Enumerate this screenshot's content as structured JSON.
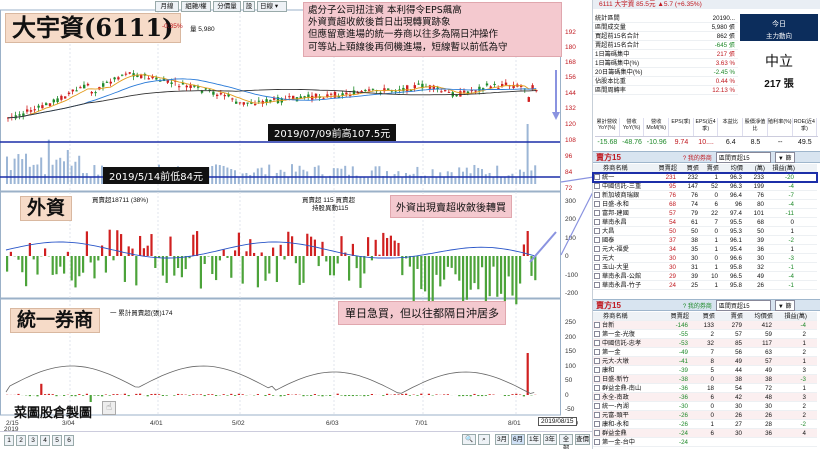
{
  "toolbar": {
    "a": "月線",
    "b": "組雜/權",
    "c": "分價量",
    "d": "設",
    "period": "日線"
  },
  "annot": {
    "title": "大宇資(6111)",
    "price_change": "-0.35%",
    "vol": "量 5,980",
    "note": [
      "處分子公司扭注資 本利得令EPS飆高",
      "外資賣超收斂後首日出現轉買跡象",
      "但應留意進場的統一券商以往多為隔日沖操作",
      "可等站上頸線後再伺機進場，短線暫以前低為守"
    ],
    "high_label": "2019/07/09前高107.5元",
    "low_label": "2019/5/14前低84元",
    "foreign": "外資",
    "foreign_note": "外資出現賣超收斂後轉買",
    "foreign_legend_a": "買賣超18711 (38%)",
    "foreign_legend_b": "買賣超 115 買賣超",
    "foreign_legend_c": "持股異動115",
    "broker": "統一券商",
    "broker_note": "單日急買，但以往都隔日沖居多",
    "broker_legend": "一 累計買賣超(張)174",
    "watermark": "菜圖股倉製圖",
    "date_box": "2019/08/15"
  },
  "x_axis": {
    "labels": [
      "2/15",
      "3/04",
      "4/01",
      "5/02",
      "6/03",
      "7/01",
      "8/01"
    ],
    "year": "2019"
  },
  "price_axis": [
    "192",
    "180",
    "168",
    "156",
    "144",
    "132",
    "120",
    "108",
    "96",
    "84",
    "72"
  ],
  "foreign_axis": [
    "300",
    "200",
    "100",
    "0",
    "-100",
    "-200",
    "-300"
  ],
  "broker_axis": [
    "250",
    "200",
    "150",
    "100",
    "50",
    "0",
    "-50",
    "-100"
  ],
  "bottom_bar": {
    "pages": [
      "1",
      "2",
      "3",
      "4",
      "5",
      "6"
    ],
    "periods": [
      "3月",
      "6月",
      "1年",
      "3年",
      "全部",
      "查價"
    ]
  },
  "panel": {
    "stock_line": "6111 大宇資 85.5元 ▲5.7 (+6.35%)",
    "stats": [
      [
        "統計區間",
        "20190..."
      ],
      [
        "區間成交量",
        "5,980 張"
      ],
      [
        "買超前15名合計",
        "862 張"
      ],
      [
        "賣超前15名合計",
        "-645 張"
      ],
      [
        "1日籌碼集中",
        "217 張"
      ],
      [
        "1日籌碼集中(%)",
        "3.63 %"
      ],
      [
        "20日籌碼集中(%)",
        "-2.45 %"
      ],
      [
        "佔股本比重",
        "0.44 %"
      ],
      [
        "區間周轉率",
        "12.13 %"
      ]
    ],
    "today_title": "今日",
    "today_sub": "主力動向",
    "today_status": "中立",
    "today_value": "217 張",
    "fin_heads": [
      "累計營收YoY(%)",
      "營收YoY(%)",
      "營收MoM(%)",
      "EPS(季)",
      "EPS(近4季)",
      "本益比",
      "股價淨值比",
      "殖利率(%)",
      "ROE(近4季)"
    ],
    "fin_vals": [
      "-15.68",
      "-48.76",
      "-10.96",
      "9.74",
      "10....",
      "6.4",
      "8.5",
      "--",
      "49.5"
    ],
    "buy_title": "賣方15",
    "sell_title": "賣方15",
    "sec_tag": "? 我的券商",
    "sec_sel": "區間買超15",
    "sec_btn": "▼ 篩",
    "cols": [
      "券商名稱",
      "買賣超",
      "買張",
      "賣張",
      "均價",
      "(萬)",
      "損益(萬)"
    ],
    "buy_rows": [
      [
        "統一",
        "231",
        "232",
        "1",
        "96.3",
        "233",
        "-20"
      ],
      [
        "中國信託-三重",
        "95",
        "147",
        "52",
        "96.3",
        "199",
        "-4"
      ],
      [
        "新加坡商瑞銀",
        "76",
        "76",
        "0",
        "96.4",
        "76",
        "-7"
      ],
      [
        "日盛-永和",
        "68",
        "74",
        "6",
        "96",
        "80",
        "-4"
      ],
      [
        "富邦-建國",
        "57",
        "79",
        "22",
        "97.4",
        "101",
        "-11"
      ],
      [
        "華南永昌",
        "54",
        "61",
        "7",
        "95.5",
        "68",
        "0"
      ],
      [
        "大昌",
        "50",
        "50",
        "0",
        "95.3",
        "50",
        "1"
      ],
      [
        "國泰",
        "37",
        "38",
        "1",
        "96.1",
        "39",
        "-2"
      ],
      [
        "元大-福愛",
        "34",
        "35",
        "1",
        "95.4",
        "36",
        "1"
      ],
      [
        "元大",
        "30",
        "30",
        "0",
        "96.6",
        "30",
        "-3"
      ],
      [
        "玉山-大里",
        "30",
        "31",
        "1",
        "95.8",
        "32",
        "-1"
      ],
      [
        "華南永昌-公館",
        "29",
        "39",
        "10",
        "96.5",
        "49",
        "-4"
      ],
      [
        "華南永昌-竹子",
        "24",
        "25",
        "1",
        "95.8",
        "26",
        "-1"
      ]
    ],
    "sell_rows": [
      [
        "台新",
        "-146",
        "133",
        "279",
        "412",
        "-4"
      ],
      [
        "第一金-光復",
        "-55",
        "2",
        "57",
        "59",
        "2"
      ],
      [
        "中國信託-忠孝",
        "-53",
        "32",
        "85",
        "117",
        "1"
      ],
      [
        "第一金",
        "-49",
        "7",
        "56",
        "63",
        "2"
      ],
      [
        "元大-大墩",
        "-41",
        "8",
        "49",
        "57",
        "1"
      ],
      [
        "康和",
        "-39",
        "5",
        "44",
        "49",
        "3"
      ],
      [
        "日盛-新竹",
        "-38",
        "0",
        "38",
        "38",
        "-3"
      ],
      [
        "群益金鼎-南山",
        "-36",
        "18",
        "54",
        "72",
        "1"
      ],
      [
        "永全-南政",
        "-36",
        "6",
        "42",
        "48",
        "3"
      ],
      [
        "統一-內湖",
        "-30",
        "0",
        "30",
        "30",
        "2"
      ],
      [
        "元富-頭平",
        "-26",
        "0",
        "26",
        "26",
        "2"
      ],
      [
        "康和-永和",
        "-26",
        "1",
        "27",
        "28",
        "-2"
      ],
      [
        "群益金鼎",
        "-24",
        "6",
        "30",
        "36",
        "4"
      ],
      [
        "第一金-台中",
        "-24",
        "",
        "",
        "",
        ""
      ]
    ]
  }
}
